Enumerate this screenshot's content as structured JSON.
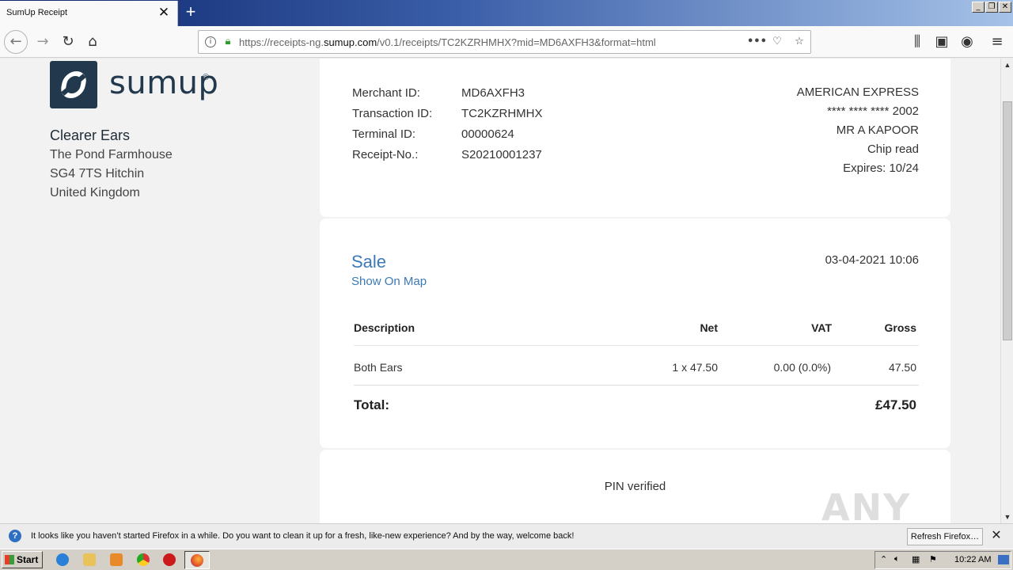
{
  "window": {
    "tab_title": "SumUp Receipt",
    "new_tab": "+",
    "close_tab": "✕"
  },
  "navbar": {
    "url_prefix": "https://receipts-ng.",
    "url_domain": "sumup.com",
    "url_suffix": "/v0.1/receipts/TC2KZRHMHX?mid=MD6AXFH3&format=html"
  },
  "merchant": {
    "logo_word": "sumup",
    "logo_reg": "®",
    "name": "Clearer Ears",
    "address": [
      "The Pond Farmhouse",
      "SG4 7TS Hitchin",
      "United Kingdom"
    ]
  },
  "ids": {
    "merchant_id_label": "Merchant ID:",
    "merchant_id": "MD6AXFH3",
    "transaction_id_label": "Transaction ID:",
    "transaction_id": "TC2KZRHMHX",
    "terminal_id_label": "Terminal ID:",
    "terminal_id": "00000624",
    "receipt_no_label": "Receipt-No.:",
    "receipt_no": "S20210001237"
  },
  "card": {
    "brand": "AMERICAN EXPRESS",
    "number": "**** **** **** 2002",
    "holder": "MR A KAPOOR",
    "entry": "Chip read",
    "expires": "Expires: 10/24"
  },
  "sale": {
    "title": "Sale",
    "map_link": "Show On Map",
    "date": "03-04-2021 10:06",
    "columns": {
      "description": "Description",
      "net": "Net",
      "vat": "VAT",
      "gross": "Gross"
    },
    "items": [
      {
        "description": "Both Ears",
        "net": "1 x 47.50",
        "vat": "0.00 (0.0%)",
        "gross": "47.50"
      }
    ],
    "total_label": "Total:",
    "total_amount": "£47.50"
  },
  "verification": {
    "text": "PIN verified"
  },
  "watermark": "ANY RUN",
  "notification": {
    "text": "It looks like you haven’t started Firefox in a while. Do you want to clean it up for a fresh, like-new experience? And by the way, welcome back!",
    "button": "Refresh Firefox…"
  },
  "taskbar": {
    "start": "Start",
    "clock": "10:22 AM"
  }
}
